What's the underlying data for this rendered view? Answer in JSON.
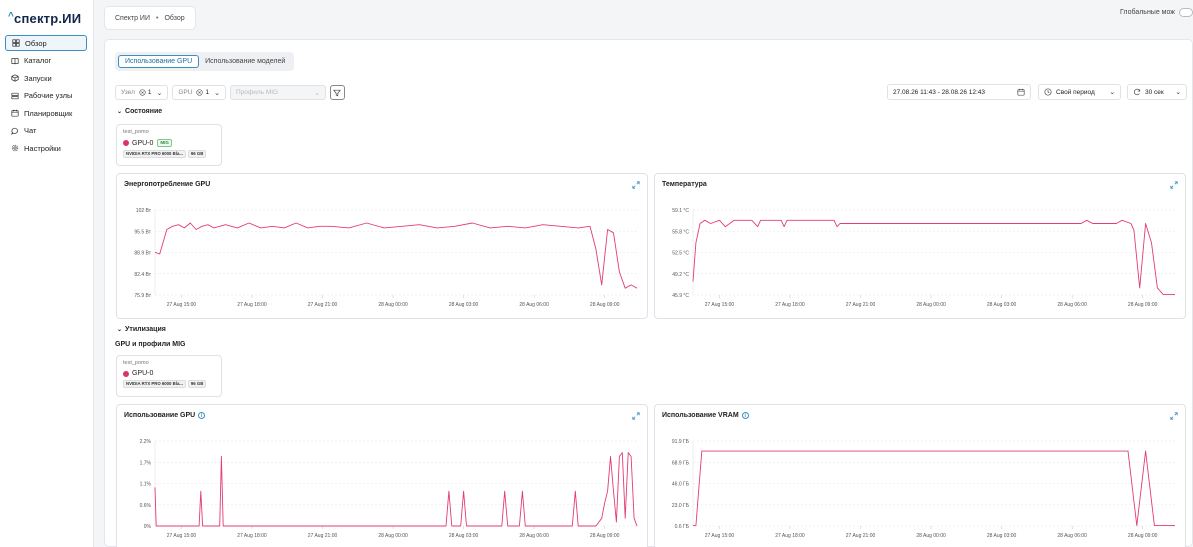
{
  "app": {
    "logo": "спектр.ИИ",
    "logo_caret": "^"
  },
  "sidebar": {
    "items": [
      {
        "label": "Обзор",
        "icon": "grid-icon",
        "active": true
      },
      {
        "label": "Каталог",
        "icon": "book-icon"
      },
      {
        "label": "Запуски",
        "icon": "cube-icon"
      },
      {
        "label": "Рабочие узлы",
        "icon": "server-icon"
      },
      {
        "label": "Планировщик",
        "icon": "calendar-icon"
      },
      {
        "label": "Чат",
        "icon": "chat-icon"
      },
      {
        "label": "Настройки",
        "icon": "gear-icon"
      }
    ]
  },
  "breadcrumb": {
    "root": "Спектр ИИ",
    "sep": "•",
    "current": "Обзор"
  },
  "global_mode": {
    "label": "Глобальные мож"
  },
  "tabs": [
    {
      "label": "Использование GPU",
      "active": true
    },
    {
      "label": "Использование моделей",
      "active": false
    }
  ],
  "filters": {
    "node": {
      "label": "Узел",
      "count": "1"
    },
    "gpu": {
      "label": "GPU",
      "count": "1"
    },
    "mig": {
      "placeholder": "Профиль MIG"
    }
  },
  "controls": {
    "date_range": "27.08.26 11:43 - 28.08.26 12:43",
    "period": "Свой период",
    "refresh": "30 сек"
  },
  "sections": {
    "state": "Состояние",
    "utilization": "Утилизация",
    "gpu_mig_subhead": "GPU и профили MIG"
  },
  "gpu_card_state": {
    "node": "test_pomo",
    "gpu": "GPU-0",
    "mig_badge": "MIG",
    "model_tag": "NVIDIA RTX PRO 6000 Bla...",
    "mem_tag": "96 GB"
  },
  "gpu_card_util": {
    "node": "test_pomo",
    "gpu": "GPU-0",
    "model_tag": "NVIDIA RTX PRO 6000 Bla...",
    "mem_tag": "96 GB"
  },
  "colors": {
    "accent": "#3b8fc2",
    "series": "#e23d74",
    "dot": "#dc3565"
  },
  "chart_data": [
    {
      "id": "power",
      "type": "line",
      "title": "Энергопотребление GPU",
      "xlabel": "",
      "ylabel": "",
      "x_ticks": [
        "27 Aug 15:00",
        "27 Aug 18:00",
        "27 Aug 21:00",
        "28 Aug 00:00",
        "28 Aug 03:00",
        "28 Aug 06:00",
        "28 Aug 09:00"
      ],
      "y_ticks": [
        "102 Вт",
        "95.5 Вт",
        "88.9 Вт",
        "82.4 Вт",
        "75.9 Вт"
      ],
      "ylim": [
        75.9,
        102
      ],
      "x": [
        0,
        0.08,
        0.2,
        0.3,
        0.4,
        0.5,
        0.6,
        0.7,
        0.8,
        0.9,
        1.0,
        1.2,
        1.4,
        1.6,
        1.8,
        2.0,
        2.2,
        2.4,
        2.6,
        2.8,
        3.0,
        3.3,
        3.6,
        3.9,
        4.2,
        4.5,
        4.8,
        5.1,
        5.4,
        5.7,
        6.0,
        6.3,
        6.6,
        6.9,
        7.2,
        7.4,
        7.5,
        7.6,
        7.7,
        7.8,
        7.9,
        8.0,
        8.1,
        8.2
      ],
      "values": [
        89,
        88.5,
        96,
        97,
        97.5,
        96.5,
        98,
        96,
        97,
        97.5,
        96.5,
        97.5,
        96.5,
        98,
        96.5,
        97,
        96.5,
        98,
        96.5,
        97,
        97,
        96.5,
        98,
        96.5,
        97,
        97.5,
        96.5,
        97,
        98,
        96.5,
        97,
        96.5,
        97.5,
        97,
        96.5,
        97,
        90,
        79,
        96,
        95,
        83,
        78,
        79,
        78
      ],
      "grid": true
    },
    {
      "id": "temp",
      "type": "line",
      "title": "Температура",
      "xlabel": "",
      "ylabel": "",
      "x_ticks": [
        "27 Aug 15:00",
        "27 Aug 18:00",
        "27 Aug 21:00",
        "28 Aug 00:00",
        "28 Aug 03:00",
        "28 Aug 06:00",
        "28 Aug 09:00"
      ],
      "y_ticks": [
        "59.1 °C",
        "55.8 °C",
        "52.5 °C",
        "49.2 °C",
        "45.9 °C"
      ],
      "ylim": [
        45.9,
        59.1
      ],
      "x": [
        0,
        0.05,
        0.12,
        0.2,
        0.3,
        0.45,
        0.55,
        0.7,
        1.0,
        1.1,
        1.15,
        1.5,
        1.55,
        1.6,
        2.0,
        2.4,
        2.45,
        2.5,
        3.0,
        4.0,
        5.0,
        6.0,
        6.6,
        6.7,
        6.8,
        7.2,
        7.3,
        7.45,
        7.5,
        7.6,
        7.7,
        7.8,
        7.9,
        8.0,
        8.1,
        8.2
      ],
      "values": [
        48,
        54,
        57,
        57.5,
        57,
        57.5,
        56.5,
        57.5,
        57.5,
        56.5,
        57.5,
        57.5,
        56.5,
        57.5,
        57.5,
        57.5,
        56.5,
        57,
        57,
        57,
        57,
        57,
        57,
        57.5,
        57,
        57,
        57.5,
        57,
        56,
        47,
        57,
        54,
        47,
        46,
        46,
        46
      ],
      "grid": true
    },
    {
      "id": "gpu_util",
      "type": "line",
      "title": "Использование GPU",
      "xlabel": "",
      "ylabel": "",
      "x_ticks": [
        "27 Aug 15:00",
        "27 Aug 18:00",
        "27 Aug 21:00",
        "28 Aug 00:00",
        "28 Aug 03:00",
        "28 Aug 06:00",
        "28 Aug 09:00"
      ],
      "y_ticks": [
        "2.2%",
        "1.7%",
        "1.1%",
        "0.6%",
        "0%"
      ],
      "ylim": [
        0,
        2.2
      ],
      "x": [
        0,
        0.02,
        0.05,
        0.6,
        0.75,
        0.78,
        0.81,
        1.0,
        1.1,
        1.13,
        1.16,
        1.3,
        2.0,
        3.0,
        4.0,
        4.9,
        4.95,
        5.0,
        5.05,
        5.1,
        5.2,
        5.25,
        5.3,
        5.5,
        5.9,
        5.95,
        6.0,
        6.2,
        6.25,
        6.3,
        6.5,
        6.9,
        7.0,
        7.1,
        7.15,
        7.2,
        7.28,
        7.3,
        7.35,
        7.4,
        7.45,
        7.5,
        7.6,
        7.65,
        7.7,
        7.75,
        7.8,
        7.85,
        7.9,
        7.95,
        8.0,
        8.05,
        8.1,
        8.15,
        8.2
      ],
      "values": [
        1.0,
        0,
        0,
        0,
        0,
        0.9,
        0,
        0,
        0,
        1.8,
        0,
        0,
        0,
        0,
        0,
        0,
        0,
        0.9,
        0,
        0,
        0,
        0.9,
        0,
        0,
        0,
        0.9,
        0,
        0,
        0.9,
        0,
        0,
        0,
        0,
        0,
        0.9,
        0,
        0,
        0,
        0,
        0,
        0,
        0,
        0.2,
        0.6,
        0.9,
        1.8,
        0.9,
        0.1,
        1.8,
        1.9,
        0.2,
        1.9,
        1.8,
        0.2,
        0
      ],
      "grid": true
    },
    {
      "id": "vram_util",
      "type": "line",
      "title": "Использование VRAM",
      "xlabel": "",
      "ylabel": "",
      "x_ticks": [
        "27 Aug 15:00",
        "27 Aug 18:00",
        "27 Aug 21:00",
        "28 Aug 00:00",
        "28 Aug 03:00",
        "28 Aug 06:00",
        "28 Aug 09:00"
      ],
      "y_ticks": [
        "91.9 ГБ",
        "68.9 ГБ",
        "46.0 ГБ",
        "23.0 ГБ",
        "0.6 ГБ"
      ],
      "ylim": [
        0.6,
        91.9
      ],
      "x": [
        0,
        0.05,
        0.15,
        1.0,
        2.0,
        3.0,
        4.0,
        5.0,
        6.0,
        7.0,
        7.4,
        7.55,
        7.7,
        7.85,
        8.0,
        8.2
      ],
      "values": [
        1,
        1,
        81,
        81,
        81,
        81,
        81,
        81,
        81,
        81,
        81,
        1,
        81,
        1,
        1,
        1
      ],
      "grid": true
    }
  ]
}
